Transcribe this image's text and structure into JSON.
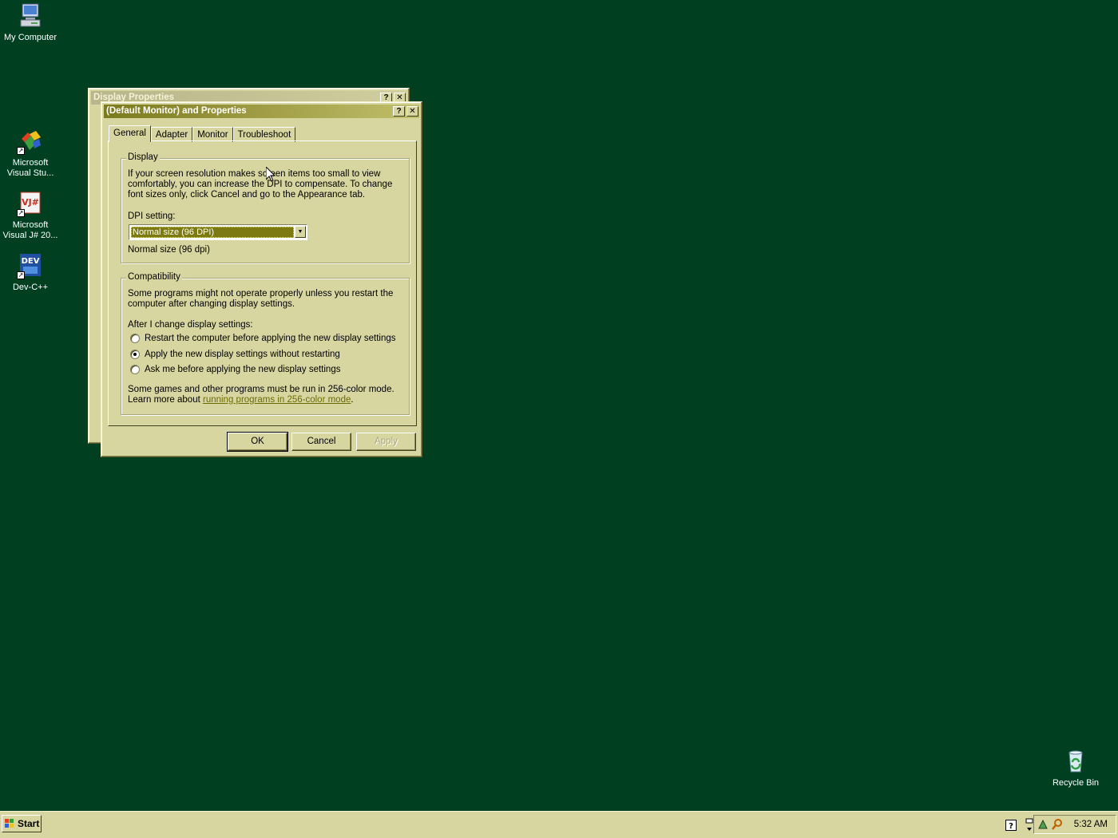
{
  "desktop": {
    "icons": [
      {
        "label": "My Computer",
        "icon": "computer-icon"
      },
      {
        "label": "Microsoft Visual Stu...",
        "icon": "visual-studio-icon"
      },
      {
        "label": "Microsoft Visual J# 20...",
        "icon": "visual-jsharp-icon"
      },
      {
        "label": "Dev-C++",
        "icon": "devcpp-icon"
      },
      {
        "label": "Recycle Bin",
        "icon": "recycle-bin-icon"
      }
    ]
  },
  "back_window": {
    "title": "Display Properties",
    "help_label": "?",
    "close_label": "✕"
  },
  "dialog": {
    "title": "(Default Monitor) and  Properties",
    "help_label": "?",
    "close_label": "✕",
    "tabs": [
      {
        "label": "General",
        "selected": true
      },
      {
        "label": "Adapter",
        "selected": false
      },
      {
        "label": "Monitor",
        "selected": false
      },
      {
        "label": "Troubleshoot",
        "selected": false
      }
    ],
    "display_group": {
      "title": "Display",
      "description_lines": [
        "If your screen resolution makes screen items too small to view",
        "comfortably, you can increase the DPI to compensate.  To change",
        "font sizes only, click Cancel and go to the Appearance tab."
      ],
      "dpi_label": "DPI setting:",
      "dpi_value": "Normal size (96 DPI)",
      "dpi_caption": "Normal size (96 dpi)"
    },
    "compat_group": {
      "title": "Compatibility",
      "description_lines": [
        "Some programs might not operate properly unless you restart the",
        "computer after changing display settings."
      ],
      "after_label": "After I change display settings:",
      "options": [
        {
          "label": "Restart the computer before applying the new display settings",
          "checked": false
        },
        {
          "label": "Apply the new display settings without restarting",
          "checked": true
        },
        {
          "label": "Ask me before applying the new display settings",
          "checked": false
        }
      ],
      "games_line1": "Some games and other programs must be run in 256-color mode.",
      "games_line2_prefix": "Learn more about ",
      "games_link": "running programs in 256-color mode",
      "games_line2_suffix": "."
    },
    "buttons": {
      "ok": "OK",
      "cancel": "Cancel",
      "apply": "Apply"
    }
  },
  "taskbar": {
    "start_label": "Start",
    "clock": "5:32 AM",
    "tray_icons": [
      "help-icon",
      "network-icon",
      "security-icon",
      "search-icon"
    ]
  },
  "colors": {
    "desktop_background": "#004020",
    "window_face": "#d8d6a0",
    "active_title_start": "#7c7a1e",
    "active_title_end": "#c2bf6c",
    "link": "#6e6c00"
  }
}
